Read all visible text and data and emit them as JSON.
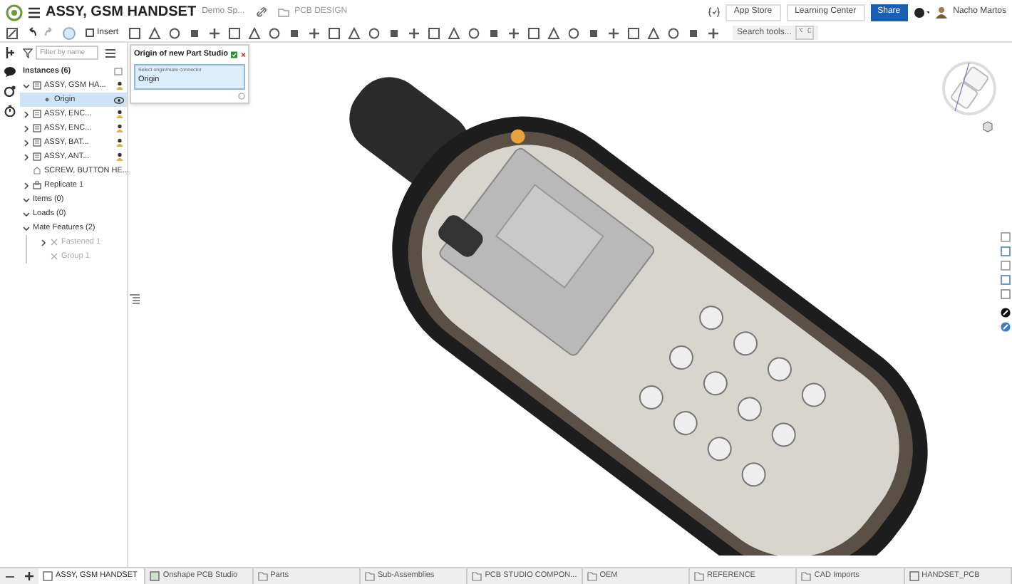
{
  "header": {
    "title": "ASSY, GSM HANDSET",
    "workspace": "Demo Sp...",
    "folder": "PCB DESIGN",
    "buttons": [
      "App Store",
      "Learning Center"
    ],
    "share": "Share",
    "user": "Nacho Martos"
  },
  "toolbar": {
    "insert": "Insert",
    "search": {
      "placeholder": "Search tools...",
      "shortcut": "⌥ C"
    }
  },
  "panel": {
    "filter": {
      "placeholder": "Filter by name"
    },
    "heading": "Instances (6)",
    "tree": [
      {
        "label": "ASSY, GSM HA...",
        "kind": "assembly",
        "expanded": true,
        "selected": false,
        "children": [
          {
            "label": "Origin",
            "kind": "origin",
            "selected": true
          }
        ]
      },
      {
        "label": "ASSY, ENC...",
        "kind": "assembly",
        "expanded": false,
        "selected": false
      },
      {
        "label": "ASSY, ENC...",
        "kind": "assembly",
        "expanded": false,
        "selected": false
      },
      {
        "label": "ASSY, BAT...",
        "kind": "assembly",
        "expanded": false,
        "selected": false
      },
      {
        "label": "ASSY, ANT...",
        "kind": "assembly",
        "expanded": false,
        "selected": false
      },
      {
        "label": "SCREW, BUTTON HE...",
        "kind": "part",
        "selected": false
      },
      {
        "label": "Replicate 1",
        "kind": "pattern",
        "expanded": false,
        "selected": false
      }
    ],
    "sections": [
      {
        "label": "Items (0)",
        "expanded": true
      },
      {
        "label": "Loads (0)",
        "expanded": true
      },
      {
        "label": "Mate Features (2)",
        "expanded": true,
        "children": [
          {
            "label": "Fastened 1",
            "disabled": true,
            "expandable": true
          },
          {
            "label": "Group 1",
            "disabled": true,
            "expandable": false
          }
        ]
      }
    ]
  },
  "dialog": {
    "title": "Origin of new Part Studio",
    "field_label": "Select origin/mate connector",
    "field_value": "Origin"
  },
  "tabs": [
    {
      "label": "ASSY, GSM HANDSET",
      "kind": "assembly",
      "selected": true
    },
    {
      "label": "Onshape PCB Studio",
      "kind": "pcb",
      "selected": false
    },
    {
      "label": "Parts",
      "kind": "folder",
      "selected": false
    },
    {
      "label": "Sub-Assemblies",
      "kind": "folder",
      "selected": false
    },
    {
      "label": "PCB STUDIO COMPON...",
      "kind": "folder",
      "selected": false
    },
    {
      "label": "OEM",
      "kind": "folder",
      "selected": false
    },
    {
      "label": "REFERENCE",
      "kind": "folder",
      "selected": false
    },
    {
      "label": "CAD Imports",
      "kind": "folder",
      "selected": false
    },
    {
      "label": "HANDSET_PCB",
      "kind": "assembly",
      "selected": false
    }
  ]
}
